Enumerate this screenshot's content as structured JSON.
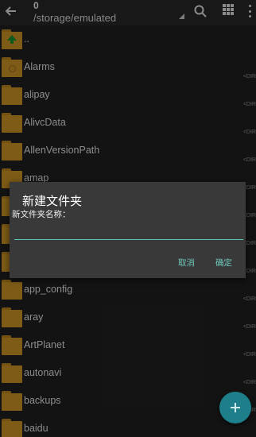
{
  "header": {
    "count": "0",
    "path": "/storage/emulated",
    "icons": [
      "back-arrow-icon",
      "dropdown-caret-icon",
      "search-icon",
      "grid-view-icon",
      "more-vert-icon"
    ]
  },
  "list": {
    "items": [
      {
        "label": "..",
        "icon": "parent-folder-icon"
      },
      {
        "label": "Alarms",
        "icon": "folder-alarm-icon"
      },
      {
        "label": "alipay",
        "icon": "folder-icon"
      },
      {
        "label": "AlivcData",
        "icon": "folder-icon"
      },
      {
        "label": "AllenVersionPath",
        "icon": "folder-icon"
      },
      {
        "label": "amap",
        "icon": "folder-icon"
      },
      {
        "label": "",
        "icon": "folder-icon"
      },
      {
        "label": "",
        "icon": "folder-icon"
      },
      {
        "label": "",
        "icon": "folder-icon"
      },
      {
        "label": "app_config",
        "icon": "folder-icon"
      },
      {
        "label": "aray",
        "icon": "folder-icon"
      },
      {
        "label": "ArtPlanet",
        "icon": "folder-icon"
      },
      {
        "label": "autonavi",
        "icon": "folder-icon"
      },
      {
        "label": "backups",
        "icon": "folder-icon"
      },
      {
        "label": "baidu",
        "icon": "folder-icon"
      }
    ],
    "meta": "<DIR"
  },
  "dialog": {
    "title": "新建文件夹",
    "label": "新文件夹名称：",
    "input_value": "",
    "cancel": "取消",
    "confirm": "确定"
  },
  "fab": {
    "icon": "plus-icon"
  },
  "colors": {
    "background": "#1e1e1e",
    "folder": "#c28d22",
    "dialog": "#393939",
    "accent": "#6ec7bb",
    "fab": "#1e7f8a"
  }
}
